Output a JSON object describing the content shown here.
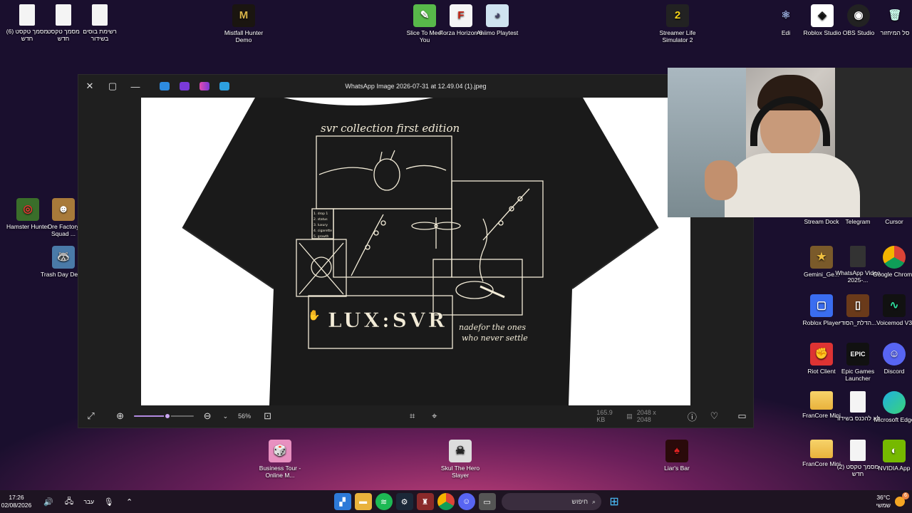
{
  "desktop_icons_left": [
    {
      "label": "מסמך טקסט (6) חדש",
      "icon": "text-document"
    },
    {
      "label": "מסמך טקסט חדש",
      "icon": "text-document"
    },
    {
      "label": "רשימת בוסים בשידור",
      "icon": "text-document"
    },
    {
      "label": "Hamster Hunter",
      "icon": "game-icon"
    },
    {
      "label": "Ore Factory Squad ...",
      "icon": "game-icon"
    },
    {
      "label": "Trash Day Demo",
      "icon": "game-icon"
    }
  ],
  "desktop_icons_top": [
    {
      "label": "Mistfall Hunter Demo"
    },
    {
      "label": "Slice To Meet You"
    },
    {
      "label": "Forza Horizon 6"
    },
    {
      "label": "Aniimo Playtest"
    },
    {
      "label": "Streamer Life Simulator 2"
    }
  ],
  "desktop_icons_right_top": [
    {
      "label": "Edi"
    },
    {
      "label": "Roblox Studio"
    },
    {
      "label": "OBS Studio"
    },
    {
      "label": "סל המיחזור"
    }
  ],
  "desktop_icons_right": [
    {
      "label": "Stream Dock"
    },
    {
      "label": "Telegram"
    },
    {
      "label": "Cursor"
    },
    {
      "label": "Gemini_Ge..."
    },
    {
      "label": "WhatsApp Video 2025-..."
    },
    {
      "label": "Google Chrome"
    },
    {
      "label": "Roblox Player"
    },
    {
      "label": "הדלת_הסודי..."
    },
    {
      "label": "Voicemod V3"
    },
    {
      "label": "Riot Client"
    },
    {
      "label": "Epic Games Launcher"
    },
    {
      "label": "Discord"
    },
    {
      "label": "FranCore Mini"
    },
    {
      "label": "לא להכנס בשידור"
    },
    {
      "label": "Microsoft Edge"
    },
    {
      "label": "FranCore Mini"
    },
    {
      "label": "מסמך טקסט (2) חדש"
    },
    {
      "label": "NVIDIA App"
    }
  ],
  "desktop_icons_bottom": [
    {
      "label": "Business Tour - Online M..."
    },
    {
      "label": "Skul The Hero Slayer"
    },
    {
      "label": "Liar's Bar"
    }
  ],
  "photos_window": {
    "title": "WhatsApp Image 2026-07-31 at 12.49.04 (1).jpeg",
    "zoom_percent": "56%",
    "file_size": "165.9 KB",
    "dimensions": "2048 x 2048",
    "zoom_slider_fraction": 0.56
  },
  "shirt_design": {
    "heading": "svr collection first edition",
    "list_lines": [
      "1. drop 1",
      "2. status",
      "3. luxury",
      "4. cigarette",
      "5. growth"
    ],
    "dice_text": "LUX:SVR",
    "tagline_line1": "nadefor the ones",
    "tagline_line2": "who never settle"
  },
  "taskbar": {
    "time": "17:26",
    "date": "02/08/2026",
    "language": "עבר",
    "search_placeholder": "חיפוש",
    "weather_temp": "36°C",
    "weather_label": "שמשי",
    "notification_count": "6"
  },
  "colors": {
    "window_bg": "#1f1f1f",
    "taskbar_bg": "#1e1422",
    "shirt": "#1a1a1a",
    "shirt_ink": "#f3ecd8"
  }
}
